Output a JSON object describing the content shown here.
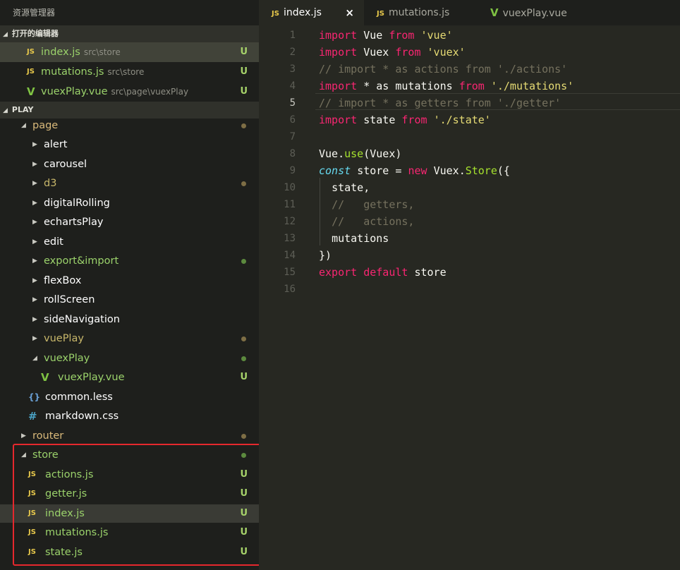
{
  "sidebar": {
    "title": "资源管理器",
    "open_editors": {
      "header": "打开的编辑器",
      "items": [
        {
          "name": "index.js",
          "path": "src\\store",
          "badge": "U",
          "icon": "js-file-icon"
        },
        {
          "name": "mutations.js",
          "path": "src\\store",
          "badge": "U",
          "icon": "js-file-icon"
        },
        {
          "name": "vuexPlay.vue",
          "path": "src\\page\\vuexPlay",
          "badge": "U",
          "icon": "vue-file-icon"
        }
      ]
    },
    "project": {
      "header": "PLAY",
      "tree": [
        {
          "label": "page",
          "type": "folder",
          "expanded": true
        },
        {
          "label": "alert",
          "type": "folder"
        },
        {
          "label": "carousel",
          "type": "folder"
        },
        {
          "label": "d3",
          "type": "folder"
        },
        {
          "label": "digitalRolling",
          "type": "folder"
        },
        {
          "label": "echartsPlay",
          "type": "folder"
        },
        {
          "label": "edit",
          "type": "folder"
        },
        {
          "label": "export&import",
          "type": "folder"
        },
        {
          "label": "flexBox",
          "type": "folder"
        },
        {
          "label": "rollScreen",
          "type": "folder"
        },
        {
          "label": "sideNavigation",
          "type": "folder"
        },
        {
          "label": "vuePlay",
          "type": "folder"
        },
        {
          "label": "vuexPlay",
          "type": "folder",
          "expanded": true
        },
        {
          "label": "vuexPlay.vue",
          "type": "file",
          "badge": "U"
        },
        {
          "label": "common.less",
          "type": "file"
        },
        {
          "label": "markdown.css",
          "type": "file"
        },
        {
          "label": "router",
          "type": "folder"
        },
        {
          "label": "store",
          "type": "folder",
          "expanded": true
        },
        {
          "label": "actions.js",
          "type": "file",
          "badge": "U"
        },
        {
          "label": "getter.js",
          "type": "file",
          "badge": "U"
        },
        {
          "label": "index.js",
          "type": "file",
          "badge": "U"
        },
        {
          "label": "mutations.js",
          "type": "file",
          "badge": "U"
        },
        {
          "label": "state.js",
          "type": "file",
          "badge": "U"
        }
      ]
    }
  },
  "tabs": [
    {
      "label": "index.js",
      "icon": "js-file-icon",
      "active": true,
      "close": "×"
    },
    {
      "label": "mutations.js",
      "icon": "js-file-icon"
    },
    {
      "label": "vuexPlay.vue",
      "icon": "vue-file-icon"
    }
  ],
  "icon_glyphs": {
    "js": "JS",
    "vue": "V",
    "braces": "{}",
    "hash": "#",
    "collapsed": "▶",
    "expanded": "◢"
  },
  "editor": {
    "current_line": 5,
    "line_numbers": [
      "1",
      "2",
      "3",
      "4",
      "5",
      "6",
      "7",
      "8",
      "9",
      "10",
      "11",
      "12",
      "13",
      "14",
      "15",
      "16"
    ],
    "lines": [
      "import Vue from 'vue'",
      "import Vuex from 'vuex'",
      "// import * as actions from './actions'",
      "import * as mutations from './mutations'",
      "// import * as getters from './getter'",
      "import state from './state'",
      "",
      "Vue.use(Vuex)",
      "const store = new Vuex.Store({",
      "  state,",
      "  //   getters,",
      "  //   actions,",
      "  mutations",
      "})",
      "export default store",
      ""
    ]
  },
  "colors": {
    "background": "#272822",
    "sidebar": "#1e1f1c",
    "highlight_box": "#e5282d",
    "untracked_badge": "#a6d26a",
    "keyword": "#f92672",
    "string": "#e6db74",
    "comment": "#75715e"
  }
}
